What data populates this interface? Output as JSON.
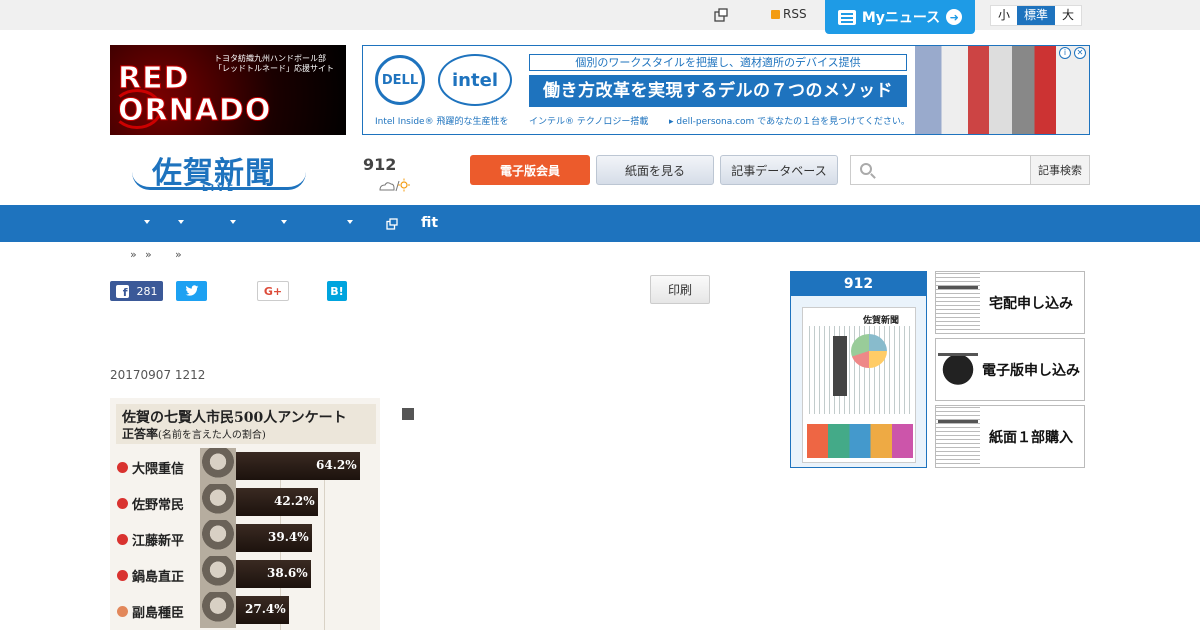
{
  "topbar": {
    "rss_label": "RSS",
    "mynews_label": "Myニュース",
    "font_sizes": [
      "小",
      "標準",
      "大"
    ],
    "active_font_size": "標準"
  },
  "banners": {
    "red_tornado": {
      "sub": "トヨタ紡織九州ハンドボール部 「レッドトルネード」応援サイト",
      "line1": "RED",
      "line2": "ORNADO"
    },
    "dell": {
      "logo_dell": "DELL",
      "logo_intel": "intel",
      "tagline_small": "個別のワークスタイルを把握し、適材適所のデバイス提供",
      "tagline_big": "働き方改革を実現するデルの７つのメソッド",
      "foot1": "Intel Inside® 飛躍的な生産性を",
      "foot2": "インテル® テクノロジー搭載",
      "foot3": "▸ dell-persona.com であなたの１台を見つけてください。"
    }
  },
  "header": {
    "logo_text": "佐賀新聞",
    "logo_sub": "LIVE",
    "date": "912",
    "member_btn": "電子版会員",
    "paper_btn": "紙面を見る",
    "db_btn": "記事データベース",
    "search_placeholder": "",
    "search_btn": "記事検索"
  },
  "nav": {
    "fit_label": "fit"
  },
  "breadcrumb": [
    "»",
    "»",
    "»"
  ],
  "social": {
    "fb_count": "281",
    "gplus_label": "G+",
    "hatena_label": "B!",
    "print_label": "印刷"
  },
  "article": {
    "posted": "20170907 1212"
  },
  "survey": {
    "title": "佐賀の七賢人市民500人アンケート",
    "subtitle": "正答率",
    "subtitle_note": "(名前を言えた人の割合)",
    "rows": [
      {
        "name": "大隈重信",
        "value": "64.2%"
      },
      {
        "name": "佐野常民",
        "value": "42.2%"
      },
      {
        "name": "江藤新平",
        "value": "39.4%"
      },
      {
        "name": "鍋島直正",
        "value": "38.6%"
      },
      {
        "name": "副島種臣",
        "value": "27.4%"
      }
    ]
  },
  "sidebar": {
    "paper_date": "912",
    "paper_masthead": "佐賀新聞",
    "btn1": "宅配申し込み",
    "btn2": "電子版申し込み",
    "btn3": "紙面１部購入"
  },
  "colors": {
    "brand_blue": "#1e73be",
    "mynews_blue": "#1e9be6",
    "member_orange": "#ec5b2c",
    "survey_dot": "#d9322f"
  }
}
